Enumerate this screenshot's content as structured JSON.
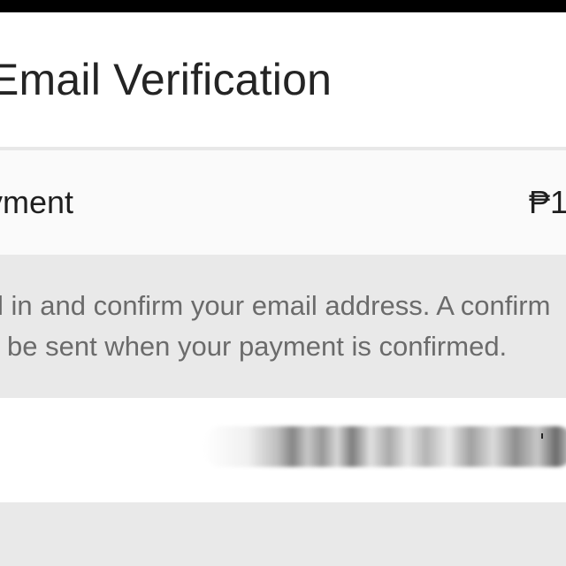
{
  "header": {
    "title": "Email Verification"
  },
  "payment": {
    "label": "ayment",
    "amount": "₱1"
  },
  "notice": {
    "line1": "l in and confirm your email address. A confirm",
    "line2": "be sent when your payment is confirmed."
  },
  "email": {
    "state": "blurred"
  },
  "colors": {
    "status_bar": "#000000",
    "notice_background": "#e9e9e9",
    "title_text": "#242424",
    "notice_text": "#6b6b6b"
  }
}
